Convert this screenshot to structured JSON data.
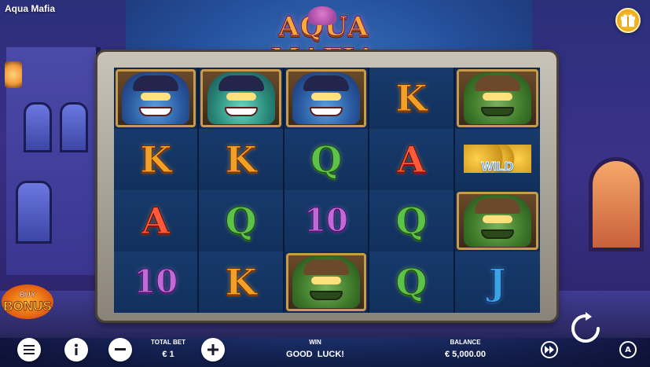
{
  "app": {
    "title": "Aqua Mafia",
    "logo_text": "AQUA MAFIA"
  },
  "buy_bonus": {
    "line1": "BUY",
    "line2": "BONUS"
  },
  "reels": [
    [
      {
        "type": "char",
        "variant": "shark-boss",
        "label": ""
      },
      {
        "type": "letter",
        "symbol": "K"
      },
      {
        "type": "letter",
        "symbol": "A"
      },
      {
        "type": "letter",
        "symbol": "10"
      }
    ],
    [
      {
        "type": "char",
        "variant": "shark-green",
        "label": ""
      },
      {
        "type": "letter",
        "symbol": "K"
      },
      {
        "type": "letter",
        "symbol": "Q"
      },
      {
        "type": "letter",
        "symbol": "K"
      }
    ],
    [
      {
        "type": "char",
        "variant": "shark-boss",
        "label": ""
      },
      {
        "type": "letter",
        "symbol": "Q"
      },
      {
        "type": "letter",
        "symbol": "10"
      },
      {
        "type": "char",
        "variant": "frog",
        "label": ""
      }
    ],
    [
      {
        "type": "letter",
        "symbol": "K"
      },
      {
        "type": "letter",
        "symbol": "A"
      },
      {
        "type": "letter",
        "symbol": "Q"
      },
      {
        "type": "letter",
        "symbol": "Q"
      }
    ],
    [
      {
        "type": "char",
        "variant": "frog",
        "label": ""
      },
      {
        "type": "wild",
        "label": "WILD"
      },
      {
        "type": "char",
        "variant": "frog",
        "label": ""
      },
      {
        "type": "letter",
        "symbol": "J"
      }
    ]
  ],
  "bottom_bar": {
    "total_bet_label": "TOTAL BET",
    "total_bet_value": "€ 1",
    "win_label": "WIN",
    "win_value": "GOOD  LUCK!",
    "balance_label": "BALANCE",
    "balance_value": "€ 5,000.00",
    "buttons": {
      "menu_icon": "menu-icon",
      "info_icon": "info-icon",
      "minus_icon": "minus-icon",
      "plus_icon": "plus-icon",
      "turbo_icon": "fast-forward-icon",
      "spin_icon": "spin-icon",
      "autoplay_icon": "autoplay-icon",
      "autoplay_letter": "A"
    }
  },
  "colors": {
    "gift_button": "#ffcf3a",
    "logo_gold": "#f9a93a",
    "wild_blue": "#3a8ae0"
  }
}
